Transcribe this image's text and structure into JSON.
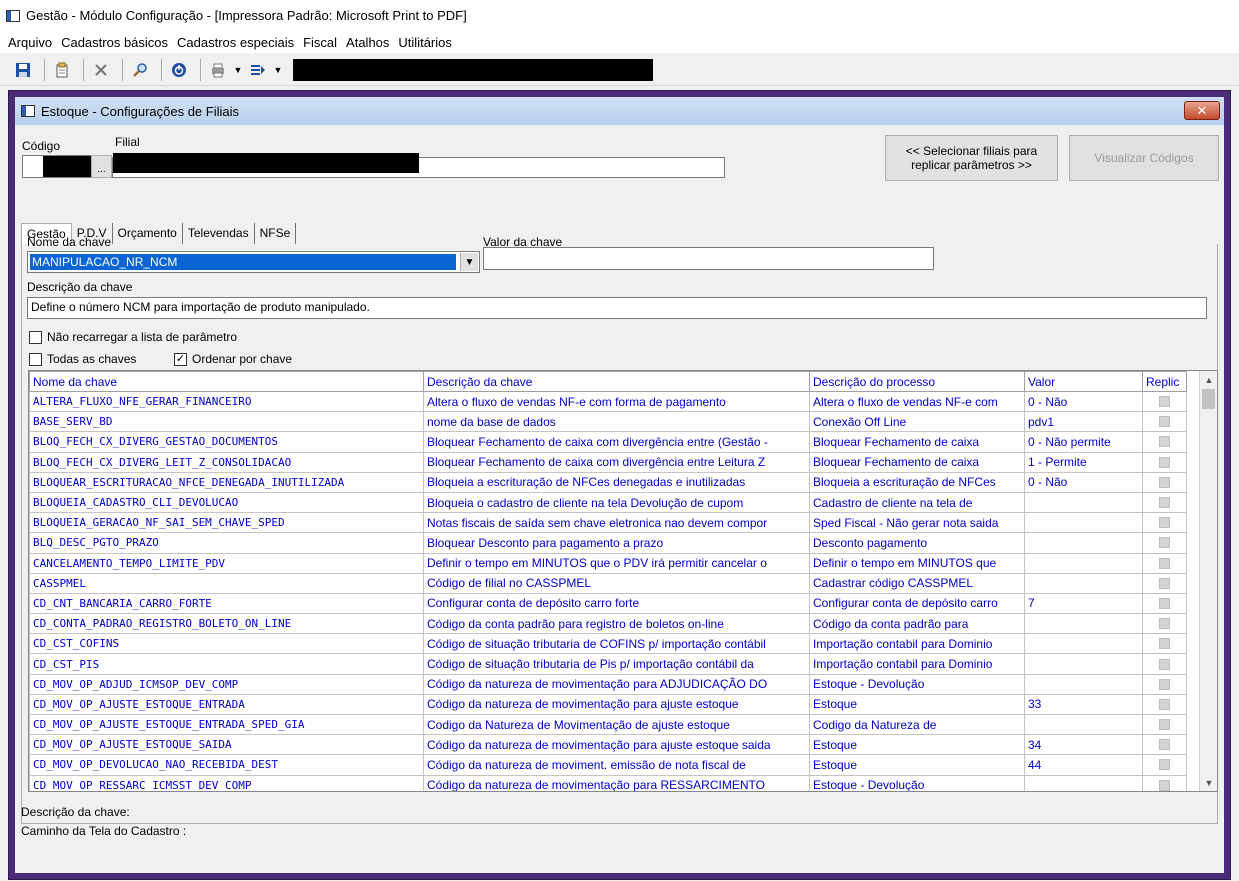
{
  "app": {
    "title": "Gestão  - Módulo Configuração - [Impressora Padrão: Microsoft Print to PDF]"
  },
  "menu": [
    "Arquivo",
    "Cadastros básicos",
    "Cadastros especiais",
    "Fiscal",
    "Atalhos",
    "Utilitários"
  ],
  "window": {
    "title": "Estoque - Configurações de Filiais",
    "close_label": "✕"
  },
  "form": {
    "codigo_label": "Código",
    "filial_label": "Filial",
    "browse_label": "...",
    "replicate_button": "<< Selecionar filiais para replicar parâmetros >>",
    "view_codes_button": "Visualizar Códigos"
  },
  "tabs": [
    "Gestão",
    "P.D.V",
    "Orçamento",
    "Televendas",
    "NFSe"
  ],
  "key": {
    "name_label": "Nome da chave",
    "name_value": "MANIPULACAO_NR_NCM",
    "value_label": "Valor da chave",
    "value_value": "",
    "desc_label": "Descrição da chave",
    "desc_value": "Define o número NCM para importação de produto manipulado."
  },
  "options": {
    "no_reload": "Não recarregar a lista de parâmetro",
    "all_keys": "Todas as chaves",
    "sort_by_key": "Ordenar por chave"
  },
  "grid": {
    "columns": [
      "Nome da chave",
      "Descrição  da chave",
      "Descrição do processo",
      "Valor",
      "Replic"
    ],
    "rows": [
      [
        "ALTERA_FLUXO_NFE_GERAR_FINANCEIRO",
        "Altera o fluxo de vendas NF-e com forma de pagamento",
        "Altera o fluxo de vendas NF-e com",
        "0 - Não"
      ],
      [
        "BASE_SERV_BD",
        "nome da base de dados",
        "Conexão Off Line",
        "pdv1"
      ],
      [
        "BLOQ_FECH_CX_DIVERG_GESTAO_DOCUMENTOS",
        "Bloquear Fechamento de caixa com divergência entre (Gestão -",
        "Bloquear Fechamento de caixa",
        "0 - Não permite"
      ],
      [
        "BLOQ_FECH_CX_DIVERG_LEIT_Z_CONSOLIDACAO",
        "Bloquear Fechamento de caixa com divergência entre Leitura Z",
        "Bloquear Fechamento de caixa",
        "1 - Permite"
      ],
      [
        "BLOQUEAR_ESCRITURACAO_NFCE_DENEGADA_INUTILIZADA",
        "Bloqueia a escrituração de NFCes denegadas e inutilizadas",
        "Bloqueia a escrituração de NFCes",
        "0 - Não"
      ],
      [
        "BLOQUEIA_CADASTRO_CLI_DEVOLUCAO",
        "Bloqueia o cadastro de cliente na tela Devolução de cupom",
        "Cadastro de cliente na tela de",
        ""
      ],
      [
        "BLOQUEIA_GERACAO_NF_SAI_SEM_CHAVE_SPED",
        "Notas fiscais de saída sem chave eletronica nao devem compor",
        "Sped Fiscal - Não gerar nota saida",
        ""
      ],
      [
        "BLQ_DESC_PGTO_PRAZO",
        "Bloquear Desconto para pagamento a prazo",
        "Desconto pagamento",
        ""
      ],
      [
        "CANCELAMENTO_TEMPO_LIMITE_PDV",
        "Definir o tempo em MINUTOS que o PDV irá permitir cancelar o",
        "Definir o tempo em MINUTOS que",
        ""
      ],
      [
        "CASSPMEL",
        "Código de filial no CASSPMEL",
        "Cadastrar código CASSPMEL",
        ""
      ],
      [
        "CD_CNT_BANCARIA_CARRO_FORTE",
        "Configurar conta de depósito carro forte",
        "Configurar conta de depósito carro",
        "7"
      ],
      [
        "CD_CONTA_PADRAO_REGISTRO_BOLETO_ON_LINE",
        "Código da conta padrão para registro de boletos on-line",
        "Código da conta padrão para",
        ""
      ],
      [
        "CD_CST_COFINS",
        "Código de situação tributaria de COFINS  p/ importação contábil",
        "Importação contabil para Dominio",
        ""
      ],
      [
        "CD_CST_PIS",
        "Código de situação tributaria de Pis  p/ importação contábil da",
        "Importação contabil para Dominio",
        ""
      ],
      [
        "CD_MOV_OP_ADJUD_ICMSOP_DEV_COMP",
        "Código da natureza de movimentação para ADJUDICAÇÃO DO",
        "Estoque - Devolução",
        ""
      ],
      [
        "CD_MOV_OP_AJUSTE_ESTOQUE_ENTRADA",
        "Código da natureza de movimentação para ajuste estoque",
        "Estoque",
        "33"
      ],
      [
        "CD_MOV_OP_AJUSTE_ESTOQUE_ENTRADA_SPED_GIA",
        "Codigo da Natureza de Movimentação de ajuste estoque",
        "Codigo da Natureza de",
        ""
      ],
      [
        "CD_MOV_OP_AJUSTE_ESTOQUE_SAIDA",
        "Código da natureza de movimentação para ajuste estoque saida",
        "Estoque",
        "34"
      ],
      [
        "CD_MOV_OP_DEVOLUCAO_NAO_RECEBIDA_DEST",
        "Código da natureza de moviment. emissão de nota fiscal de",
        "Estoque",
        "44"
      ],
      [
        "CD_MOV_OP_RESSARC_ICMSST_DEV_COMP",
        "Código da natureza de movimentação para RESSARCIMENTO",
        "Estoque - Devolução",
        ""
      ]
    ]
  },
  "footer": {
    "desc_label": "Descrição da chave:",
    "path_label": "Caminho da Tela do Cadastro :"
  }
}
